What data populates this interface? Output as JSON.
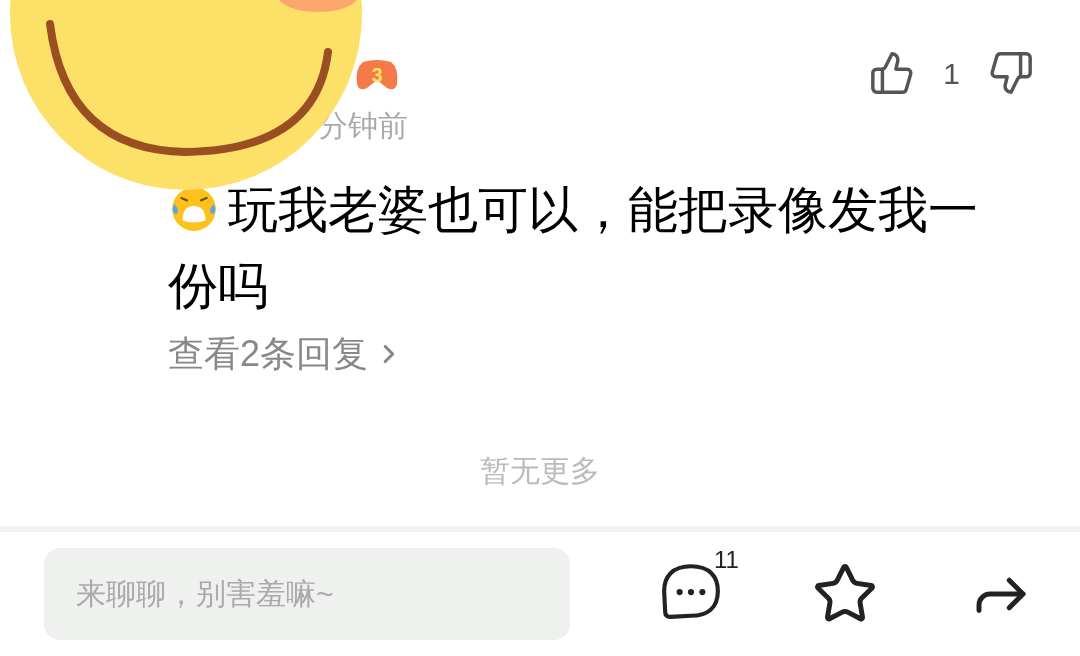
{
  "comment": {
    "level_badge": "3",
    "time": "分钟前",
    "text": "玩我老婆也可以，能把录像发我一份吗",
    "replies_link": "查看2条回复",
    "like_count": "1"
  },
  "footer_note": "暂无更多",
  "bottom_bar": {
    "input": {
      "placeholder": "来聊聊，别害羞嘛~"
    },
    "comment_count": "11"
  }
}
